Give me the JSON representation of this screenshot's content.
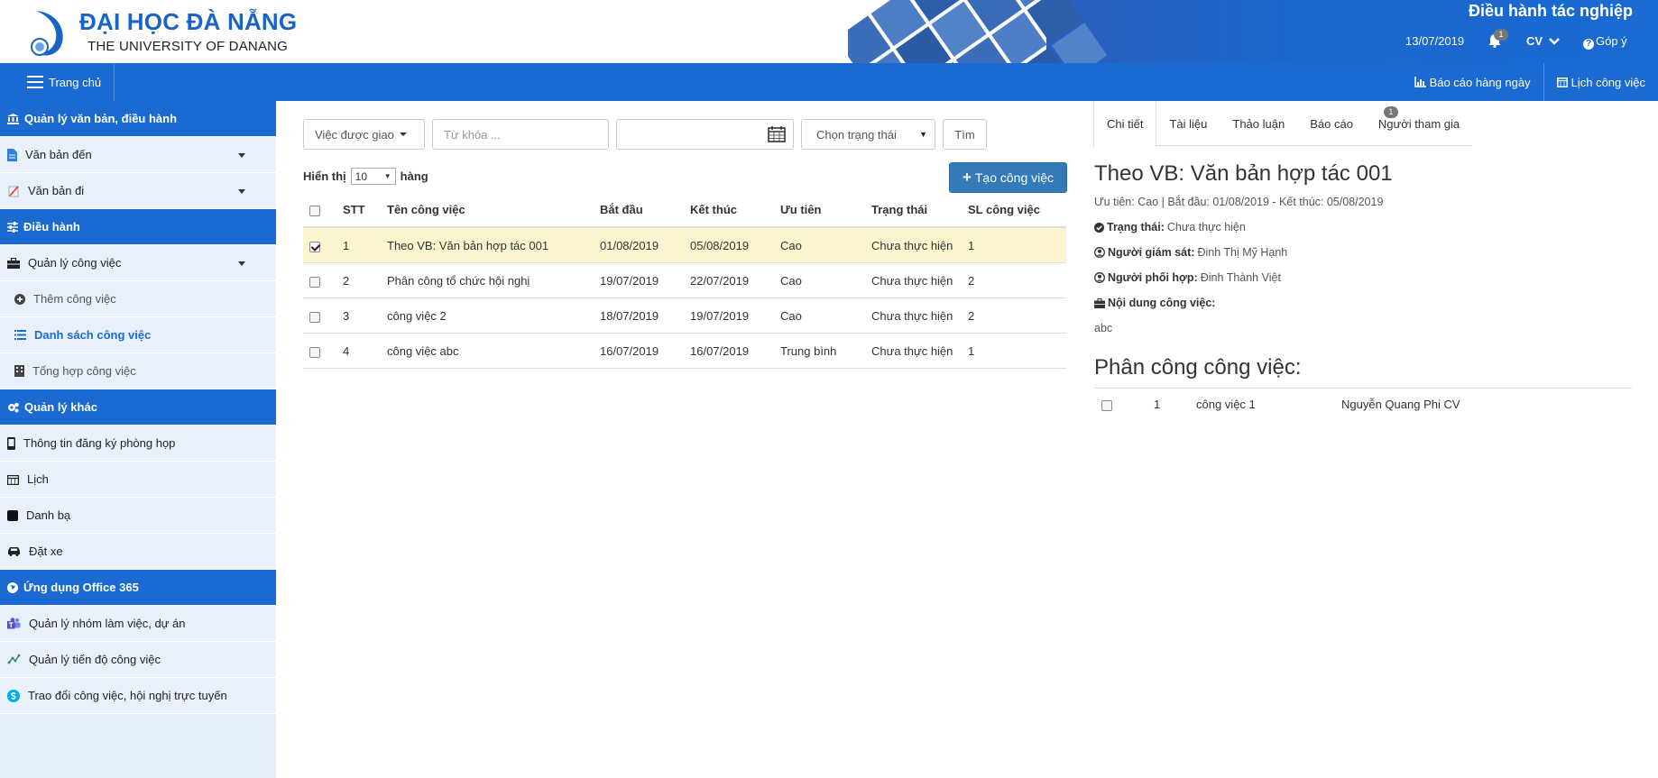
{
  "header": {
    "logo_title": "ĐẠI HỌC ĐÀ NẴNG",
    "logo_subtitle": "THE UNIVERSITY OF DANANG",
    "app_title": "Điều hành tác nghiệp",
    "date": "13/07/2019",
    "notification_count": "1",
    "user": "CV",
    "feedback": "Góp ý",
    "brand_color": "#1a6ad2"
  },
  "navbar": {
    "home": "Trang chủ",
    "daily_report": "Báo cáo hàng ngày",
    "work_calendar": "Lịch công việc"
  },
  "sidebar": {
    "groups": [
      {
        "label": "Quản lý văn bản, điều hành",
        "icon": "bank-icon"
      },
      {
        "label": "Điều hành",
        "icon": "sliders-icon"
      },
      {
        "label": "Quản lý khác",
        "icon": "cogs-icon"
      },
      {
        "label": "Ứng dụng Office 365",
        "icon": "globe-icon"
      }
    ],
    "items": [
      {
        "label": "Văn bản đến",
        "icon": "document-icon"
      },
      {
        "label": "Văn bản đi",
        "icon": "send-document-icon"
      },
      {
        "label": "Quản lý công việc",
        "icon": "briefcase-icon"
      },
      {
        "label": "Thêm công việc",
        "icon": "plus-circle-icon"
      },
      {
        "label": "Danh sách công việc",
        "icon": "list-icon"
      },
      {
        "label": "Tổng hợp công việc",
        "icon": "building-icon"
      },
      {
        "label": "Thông tin đăng ký phòng họp",
        "icon": "mobile-icon"
      },
      {
        "label": "Lịch",
        "icon": "calendar-icon"
      },
      {
        "label": "Danh bạ",
        "icon": "contact-book-icon"
      },
      {
        "label": "Đặt xe",
        "icon": "car-icon"
      },
      {
        "label": "Quản lý nhóm làm việc, dự án",
        "icon": "teams-icon"
      },
      {
        "label": "Quản lý tiến độ công việc",
        "icon": "planner-icon"
      },
      {
        "label": "Trao đổi công việc, hội nghị trực tuyến",
        "icon": "skype-icon"
      }
    ]
  },
  "filters": {
    "assigned": "Việc được giao",
    "keyword_placeholder": "Từ khóa ...",
    "date_value": "",
    "status": "Chọn trạng thái",
    "search_button": "Tìm"
  },
  "list": {
    "show_label": "Hiển thị",
    "page_size": "10",
    "rows_label": "hàng",
    "create_button": "Tạo công việc",
    "columns": [
      "STT",
      "Tên công việc",
      "Bắt đầu",
      "Kết thúc",
      "Ưu tiên",
      "Trạng thái",
      "SL công việc"
    ],
    "rows": [
      {
        "stt": "1",
        "name": "Theo VB: Văn bản hợp tác 001",
        "start": "01/08/2019",
        "end": "05/08/2019",
        "priority": "Cao",
        "status": "Chưa thực hiện",
        "count": "1",
        "checked": true
      },
      {
        "stt": "2",
        "name": "Phân công tổ chức hội nghị",
        "start": "19/07/2019",
        "end": "22/07/2019",
        "priority": "Cao",
        "status": "Chưa thực hiện",
        "count": "2",
        "checked": false
      },
      {
        "stt": "3",
        "name": "công việc 2",
        "start": "18/07/2019",
        "end": "19/07/2019",
        "priority": "Cao",
        "status": "Chưa thực hiện",
        "count": "2",
        "checked": false
      },
      {
        "stt": "4",
        "name": "công việc abc",
        "start": "16/07/2019",
        "end": "16/07/2019",
        "priority": "Trung bình",
        "status": "Chưa thực hiện",
        "count": "1",
        "checked": false
      }
    ]
  },
  "detail": {
    "tabs": [
      "Chi tiết",
      "Tài liệu",
      "Thảo luận",
      "Báo cáo",
      "Người tham gia"
    ],
    "participants_badge": "1",
    "title": "Theo VB: Văn bản hợp tác 001",
    "meta": "Ưu tiên: Cao | Bắt đầu: 01/08/2019 - Kết thúc: 05/08/2019",
    "status_label": "Trạng thái:",
    "status_value": "Chưa thực hiện",
    "supervisor_label": "Người giám sát:",
    "supervisor_value": "Đinh Thị Mỹ Hạnh",
    "coordinator_label": "Người phối hợp:",
    "coordinator_value": "Đinh Thành Việt",
    "content_label": "Nội dung công việc:",
    "content_value": "abc",
    "assign_title": "Phân công công việc:",
    "assignments": [
      {
        "stt": "1",
        "name": "công việc 1",
        "assignee": "Nguyễn Quang Phi CV"
      }
    ]
  }
}
